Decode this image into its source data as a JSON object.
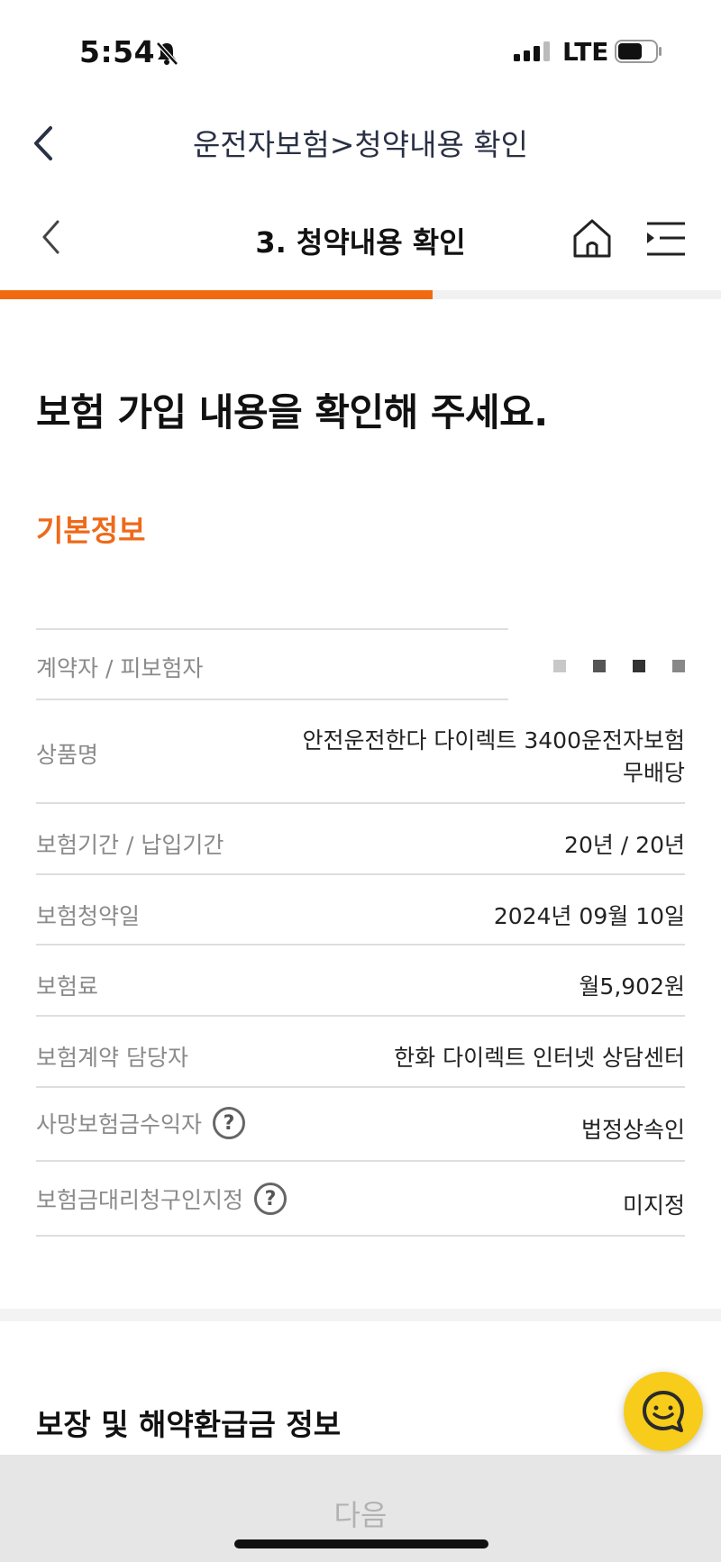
{
  "status_bar": {
    "time": "5:54",
    "network": "LTE"
  },
  "top_nav": {
    "title": "운전자보험>청약내용 확인"
  },
  "sub_nav": {
    "title": "3. 청약내용 확인"
  },
  "progress": {
    "fraction": 0.6
  },
  "page": {
    "heading": "보험 가입 내용을 확인해 주세요.",
    "section_title": "기본정보"
  },
  "basic_info": {
    "rows": [
      {
        "label": "계약자 / 피보험자",
        "value": ""
      },
      {
        "label": "상품명",
        "value_line1": "안전운전한다 다이렉트 3400운전자보험",
        "value_line2": "무배당"
      },
      {
        "label": "보험기간 / 납입기간",
        "value": "20년 / 20년"
      },
      {
        "label": "보험청약일",
        "value": "2024년 09월 10일"
      },
      {
        "label": "보험료",
        "value": "월5,902원"
      },
      {
        "label": "보험계약 담당자",
        "value": "한화 다이렉트 인터넷 상담센터"
      },
      {
        "label": "사망보험금수익자",
        "value": "법정상속인",
        "help": "?"
      },
      {
        "label": "보험금대리청구인지정",
        "value": "미지정",
        "help": "?"
      }
    ]
  },
  "section2_title": "보장 및 해약환급금 정보",
  "bottom": {
    "next_label": "다음"
  },
  "colors": {
    "accent": "#f26a10",
    "chat": "#f7cc1b"
  }
}
